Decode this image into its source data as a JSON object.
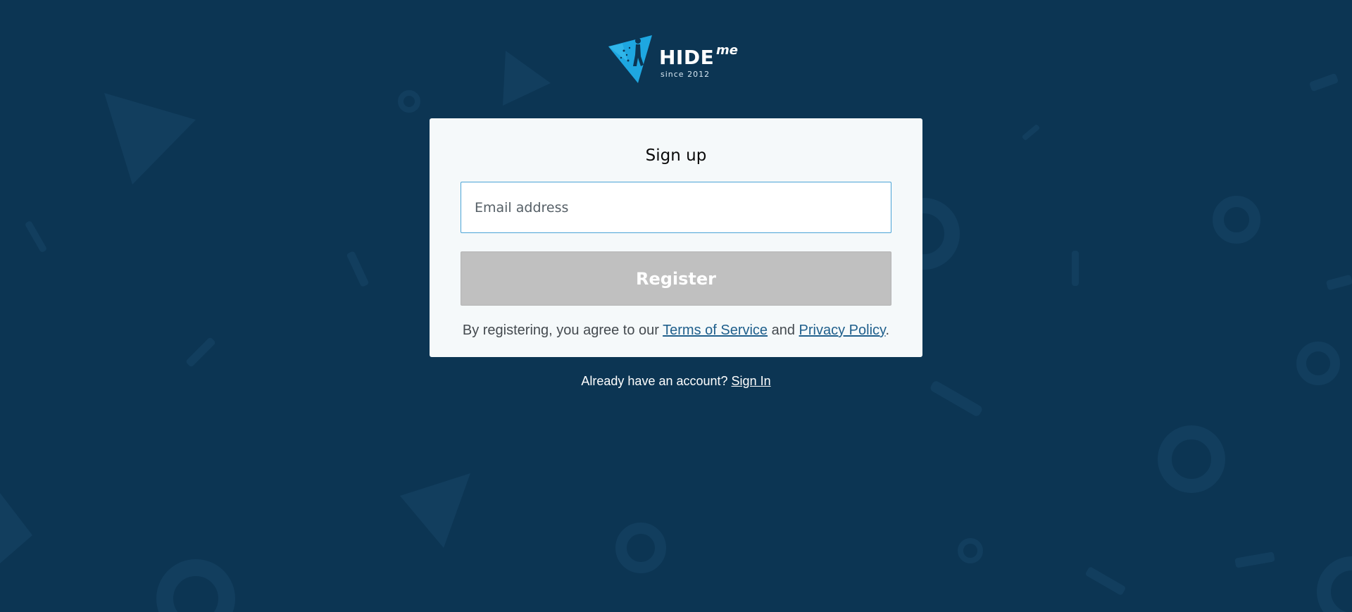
{
  "brand": {
    "wordmark": "HIDE",
    "suffix": "me",
    "since": "since 2012",
    "logo_icon": "triangle-walker-icon",
    "accent_color": "#1ea7e1"
  },
  "background": {
    "color": "#0c3553",
    "shape_color": "#123e5e"
  },
  "signup": {
    "title": "Sign up",
    "email_placeholder": "Email address",
    "email_value": "",
    "register_label": "Register",
    "register_state": "disabled"
  },
  "legal": {
    "prefix": "By registering, you agree to our ",
    "terms_label": "Terms of Service",
    "connector": " and ",
    "privacy_label": "Privacy Policy",
    "suffix": "."
  },
  "signin": {
    "prompt": "Already have an account? ",
    "link_label": "Sign In"
  }
}
